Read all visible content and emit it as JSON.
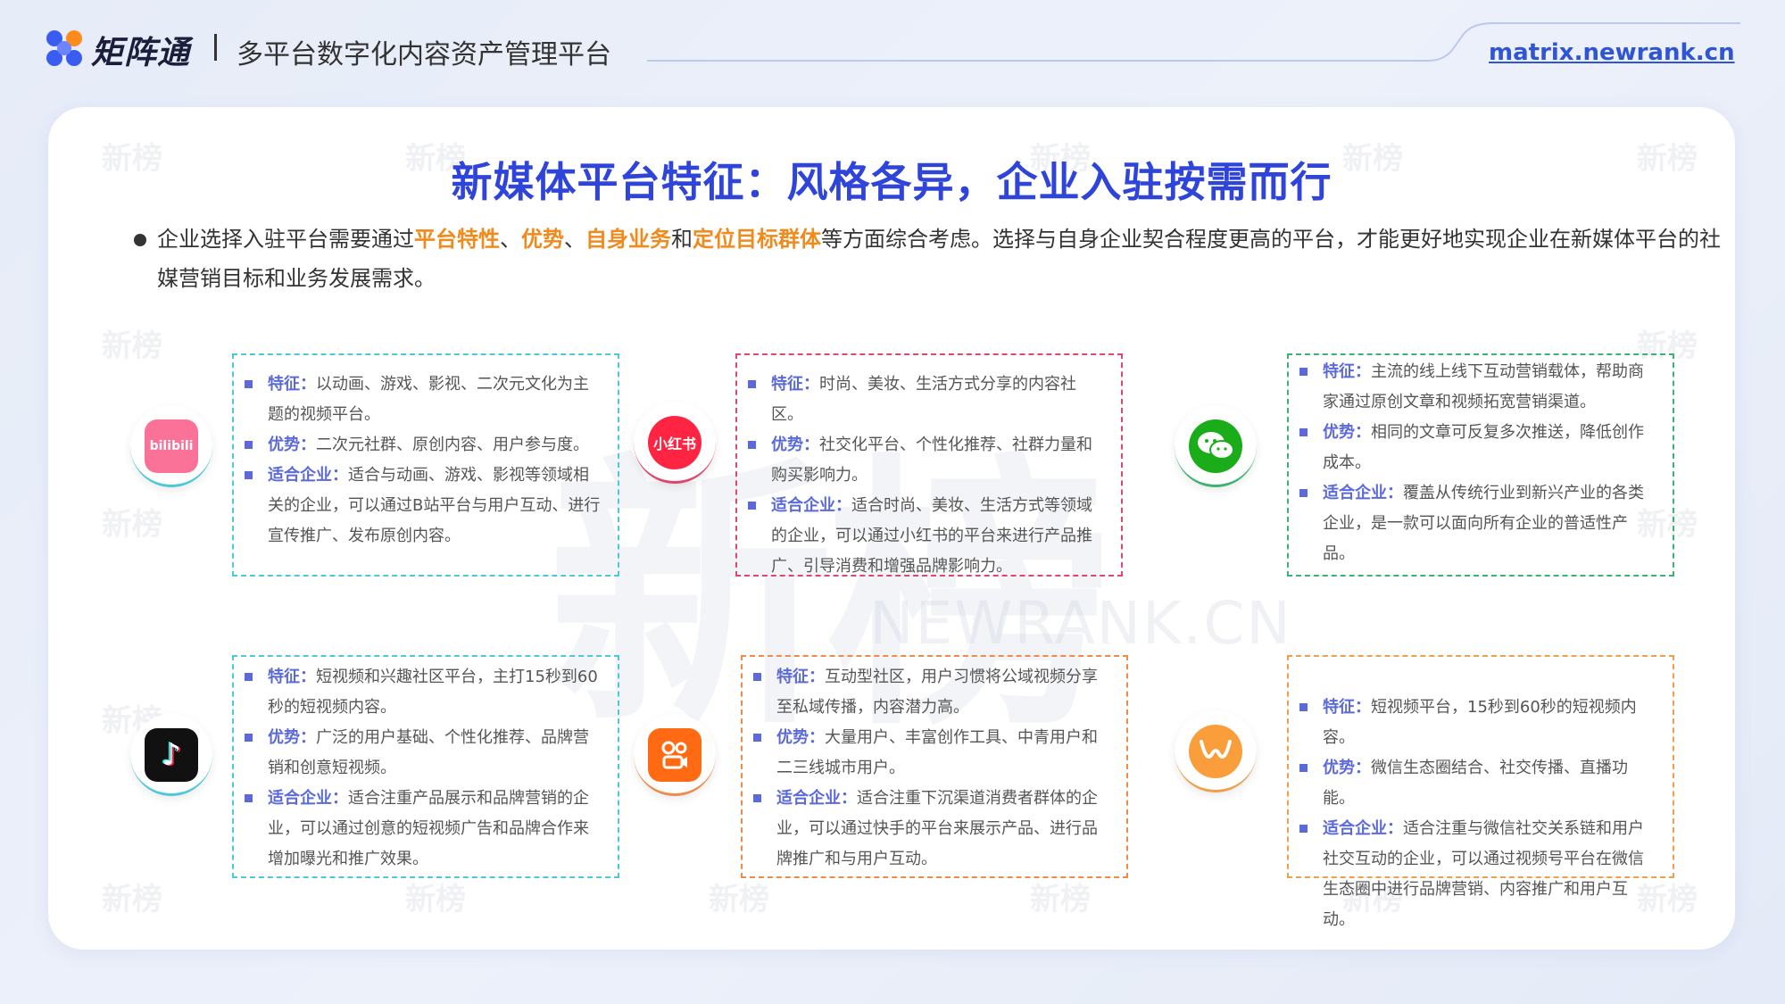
{
  "header": {
    "brand_name": "矩阵通",
    "brand_sub": "多平台数字化内容资产管理平台",
    "site": "matrix.newrank.cn"
  },
  "watermark": {
    "big": "新榜",
    "sub": "NEWRANK.CN",
    "small": "新榜"
  },
  "title": "新媒体平台特征：风格各异，企业入驻按需而行",
  "intro": {
    "p1": "企业选择入驻平台需要通过",
    "h1": "平台特性",
    "p2": "、",
    "h2": "优势",
    "p3": "、",
    "h3": "自身业务",
    "p4": "和",
    "h4": "定位目标群体",
    "p5": "等方面综合考虑。选择与自身企业契合程度更高的平台，才能更好地实现企业在新媒体平台的社媒营销目标和业务发展需求。"
  },
  "labels": {
    "feature": "特征：",
    "advantage": "优势：",
    "suitable": "适合企业："
  },
  "platforms": [
    {
      "icon": "bilibili-icon",
      "icon_text": "bilibili",
      "color": "#fb7299",
      "border": "#4cc9d8",
      "feature": "以动画、游戏、影视、二次元文化为主题的视频平台。",
      "advantage": "二次元社群、原创内容、用户参与度。",
      "suitable": "适合与动画、游戏、影视等领域相关的企业，可以通过B站平台与用户互动、进行宣传推广、发布原创内容。"
    },
    {
      "icon": "xiaohongshu-icon",
      "icon_text": "小红书",
      "color": "#ff2442",
      "border": "#e0466b",
      "feature": "时尚、美妆、生活方式分享的内容社区。",
      "advantage": "社交化平台、个性化推荐、社群力量和购买影响力。",
      "suitable": "适合时尚、美妆、生活方式等领域的企业，可以通过小红书的平台来进行产品推广、引导消费和增强品牌影响力。"
    },
    {
      "icon": "wechat-icon",
      "icon_text": "",
      "color": "#1aad19",
      "border": "#3cb371",
      "feature": "主流的线上线下互动营销载体，帮助商家通过原创文章和视频拓宽营销渠道。",
      "advantage": "相同的文章可反复多次推送，降低创作成本。",
      "suitable": "覆盖从传统行业到新兴产业的各类企业，是一款可以面向所有企业的普适性产品。"
    },
    {
      "icon": "douyin-icon",
      "icon_text": "♪",
      "color": "#111111",
      "border": "#4cc9d8",
      "feature": "短视频和兴趣社区平台，主打15秒到60秒的短视频内容。",
      "advantage": "广泛的用户基础、个性化推荐、品牌营销和创意短视频。",
      "suitable": "适合注重产品展示和品牌营销的企业，可以通过创意的短视频广告和品牌合作来增加曝光和推广效果。"
    },
    {
      "icon": "kuaishou-icon",
      "icon_text": "",
      "color": "#ff6a13",
      "border": "#f0894a",
      "feature": "互动型社区，用户习惯将公域视频分享至私域传播，内容潜力高。",
      "advantage": "大量用户、丰富创作工具、中青用户和二三线城市用户。",
      "suitable": "适合注重下沉渠道消费者群体的企业，可以通过快手的平台来展示产品、进行品牌推广和与用户互动。"
    },
    {
      "icon": "wechat-channels-icon",
      "icon_text": "",
      "color": "#fa9d3b",
      "border": "#f0a04a",
      "feature": "短视频平台，15秒到60秒的短视频内容。",
      "advantage": "微信生态圈结合、社交传播、直播功能。",
      "suitable": "适合注重与微信社交关系链和用户社交互动的企业，可以通过视频号平台在微信生态圈中进行品牌营销、内容推广和用户互动。"
    }
  ]
}
